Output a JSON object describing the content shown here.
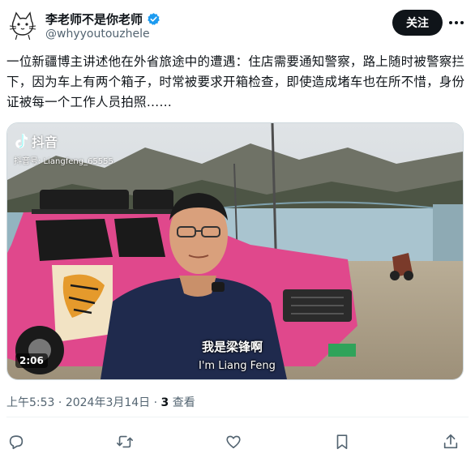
{
  "author": {
    "display_name": "李老师不是你老师",
    "handle": "@whyyoutouzhele",
    "verified": true
  },
  "follow_button": {
    "label": "关注"
  },
  "tweet": {
    "text": "一位新疆博主讲述他在外省旅途中的遭遇：住店需要通知警察，路上随时被警察拦下，因为车上有两个箱子，时常被要求开箱检查，即使造成堵车也在所不惜，身份证被每一个工作人员拍照……"
  },
  "media": {
    "watermark_app": "抖音",
    "watermark_id": "抖音号: Liangfeng_65555",
    "duration": "2:06",
    "subtitle_cn": "我是梁锋啊",
    "subtitle_en": "I'm Liang Feng"
  },
  "meta": {
    "time": "上午5:53",
    "separator": "·",
    "date": "2024年3月14日",
    "views_count": "3",
    "views_label": "查看"
  },
  "colors": {
    "text": "#0f1419",
    "secondary": "#536471",
    "verified": "#1d9bf0",
    "car_pink": "#e0488c"
  }
}
